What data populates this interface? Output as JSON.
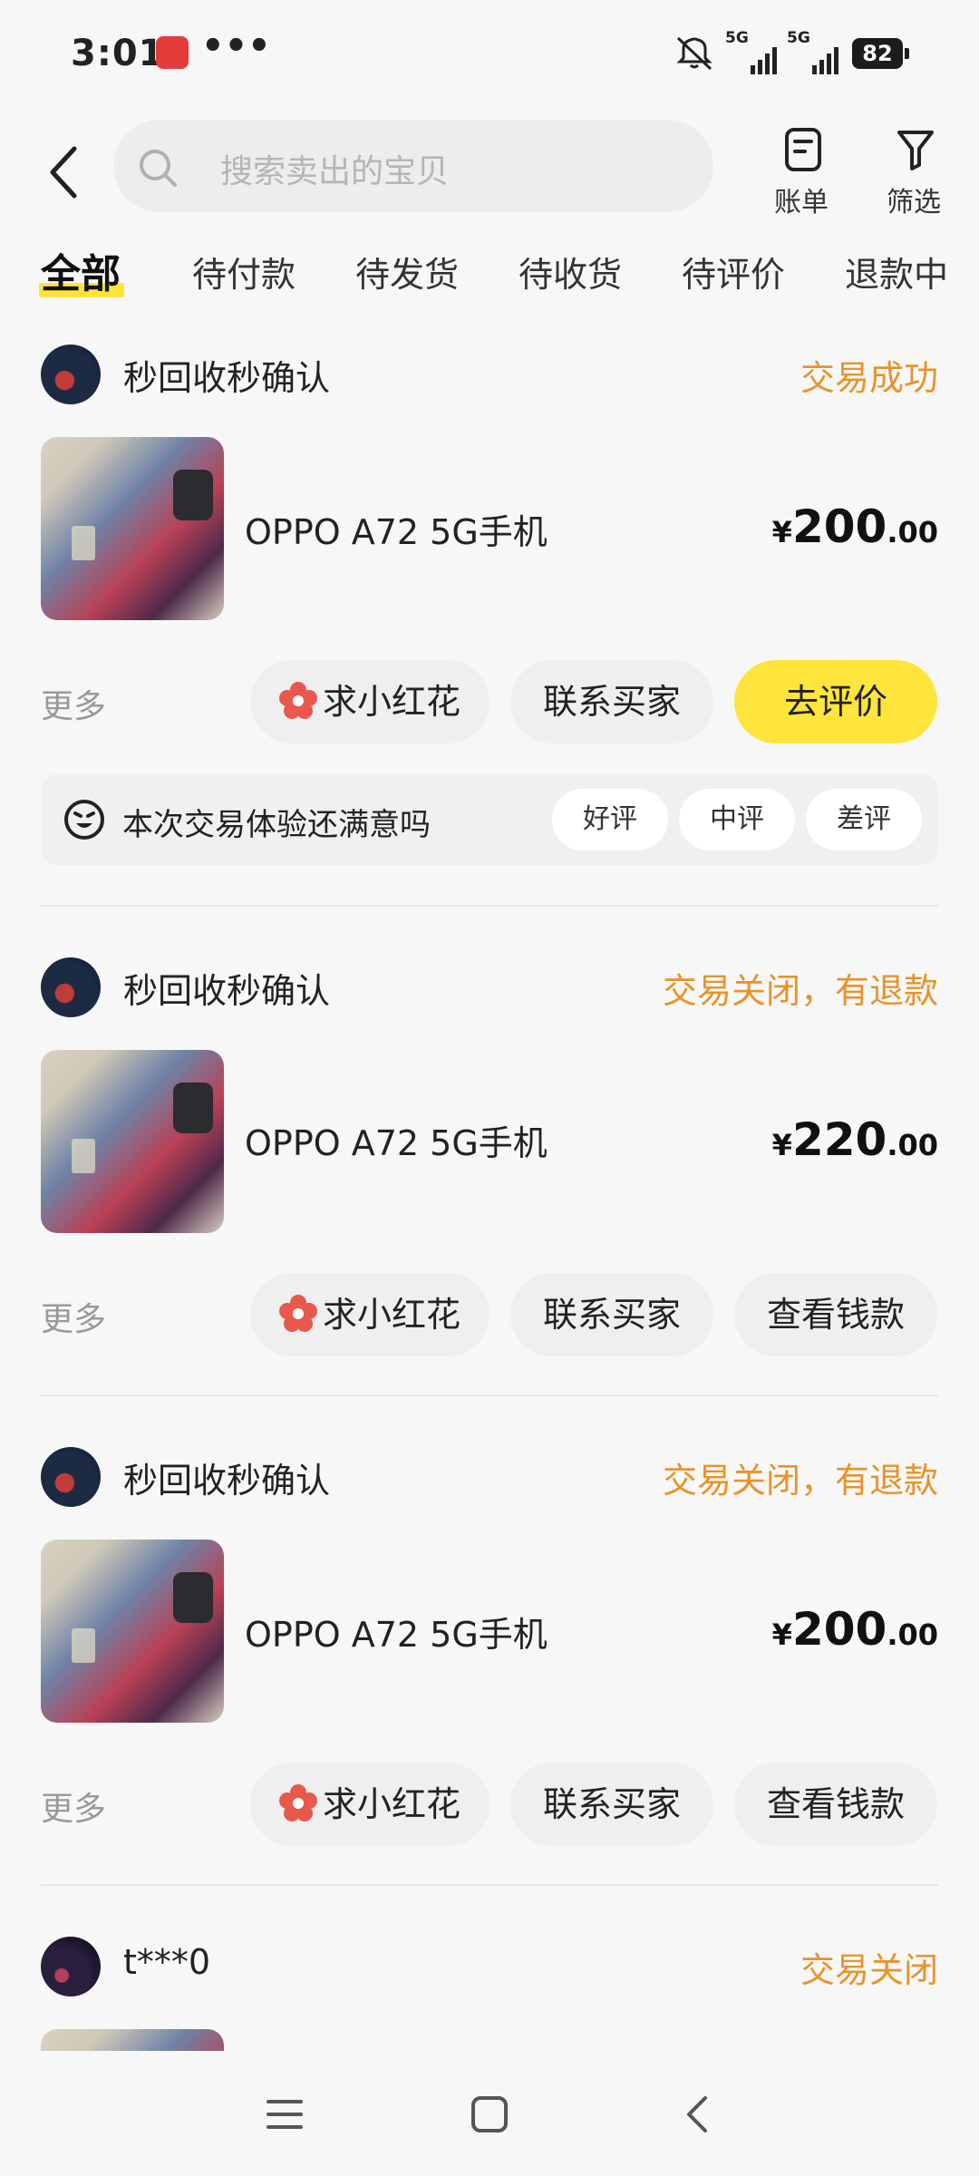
{
  "status_bar": {
    "time": "3:01",
    "dots": "•••",
    "signal1": "5G",
    "signal2": "5G",
    "battery": "82"
  },
  "header": {
    "search_placeholder": "搜索卖出的宝贝",
    "bill_label": "账单",
    "filter_label": "筛选"
  },
  "tabs": [
    "全部",
    "待付款",
    "待发货",
    "待收货",
    "待评价",
    "退款中"
  ],
  "orders": [
    {
      "shop": "秒回收秒确认",
      "status": "交易成功",
      "title": "OPPO A72 5G手机",
      "currency": "¥",
      "price_int": "200",
      "price_dec": ".00",
      "more": "更多",
      "btn1": "求小红花",
      "btn2": "联系买家",
      "btn3": "去评价",
      "review": {
        "question": "本次交易体验还满意吗",
        "good": "好评",
        "neutral": "中评",
        "bad": "差评"
      }
    },
    {
      "shop": "秒回收秒确认",
      "status": "交易关闭，有退款",
      "title": "OPPO A72 5G手机",
      "currency": "¥",
      "price_int": "220",
      "price_dec": ".00",
      "more": "更多",
      "btn1": "求小红花",
      "btn2": "联系买家",
      "btn3": "查看钱款"
    },
    {
      "shop": "秒回收秒确认",
      "status": "交易关闭，有退款",
      "title": "OPPO A72 5G手机",
      "currency": "¥",
      "price_int": "200",
      "price_dec": ".00",
      "more": "更多",
      "btn1": "求小红花",
      "btn2": "联系买家",
      "btn3": "查看钱款"
    },
    {
      "shop": "t***0",
      "status": "交易关闭"
    }
  ],
  "colors": {
    "accent_yellow": "#ffe53b",
    "status_orange": "#e8932c",
    "background": "#f7f7f7"
  }
}
